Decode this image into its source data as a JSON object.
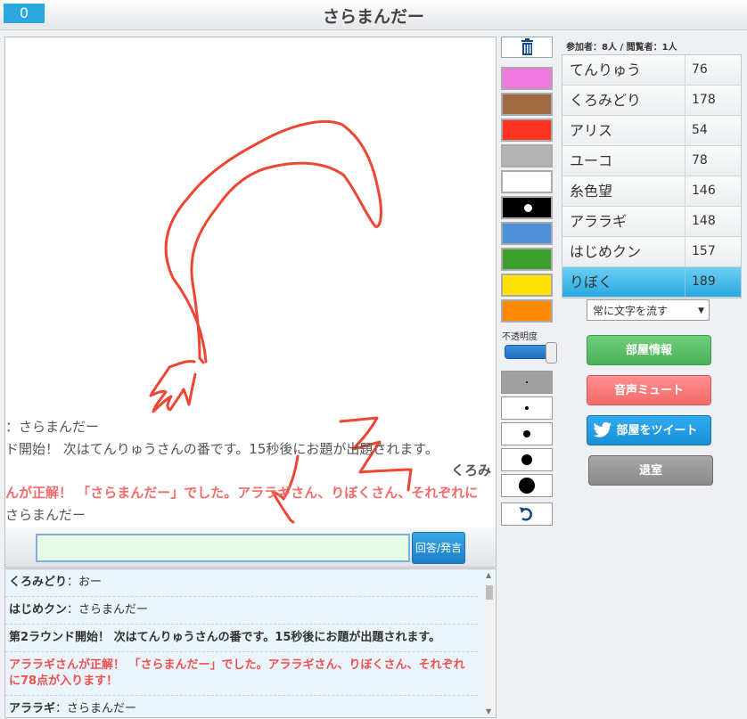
{
  "header": {
    "round_badge": "0",
    "title": "さらまんだー"
  },
  "canvas_messages": [
    {
      "text": "：さらまんだー",
      "style": "plain"
    },
    {
      "text": "ド開始！ 次はてんりゅうさんの番です。15秒後にお題が出題されます。",
      "style": "plain"
    },
    {
      "text": "くろみ",
      "style": "bold"
    },
    {
      "text": "んが正解！ 「さらまんだー」でした。アララギさん、りぼくさん、それぞれに",
      "style": "red"
    },
    {
      "text": "さらまんだー",
      "style": "plain"
    }
  ],
  "answer": {
    "input_value": "",
    "button_label": "回答/発言"
  },
  "chat": [
    {
      "name": "くろみどり",
      "sep": "：",
      "text": "おー",
      "kind": "user"
    },
    {
      "name": "はじめクン",
      "sep": "：",
      "text": "さらまんだー",
      "kind": "user"
    },
    {
      "name": "",
      "sep": "",
      "text": "第2ラウンド開始！ 次はてんりゅうさんの番です。15秒後にお題が出題されます。",
      "kind": "sys"
    },
    {
      "name": "",
      "sep": "",
      "text": "アララギさんが正解！ 「さらまんだー」でした。アララギさん、りぼくさん、それぞれに78点が入ります！",
      "kind": "ok"
    },
    {
      "name": "アララギ",
      "sep": "：",
      "text": "さらまんだー",
      "kind": "user"
    }
  ],
  "tools": {
    "colors": [
      "#f07adf",
      "#a06a40",
      "#ff3322",
      "#b3b3b3",
      "#ffffff",
      "#000000",
      "#4f92d8",
      "#3aa02a",
      "#ffe200",
      "#ff8a00"
    ],
    "selected_color": "#000000",
    "opacity_label": "不透明度",
    "opacity_value": 1.0,
    "trash_icon": "trash-icon",
    "undo_icon": "undo-icon"
  },
  "players_header": {
    "participants_label": "参加者",
    "participants_value": "8人",
    "separator": "/",
    "viewers_label": "閲覧者",
    "viewers_value": "1人"
  },
  "players": [
    {
      "name": "てんりゅう",
      "score": "76",
      "active": false
    },
    {
      "name": "くろみどり",
      "score": "178",
      "active": false
    },
    {
      "name": "アリス",
      "score": "54",
      "active": false
    },
    {
      "name": "ユーコ",
      "score": "78",
      "active": false
    },
    {
      "name": "糸色望",
      "score": "146",
      "active": false
    },
    {
      "name": "アララギ",
      "score": "148",
      "active": false
    },
    {
      "name": "はじめクン",
      "score": "157",
      "active": false
    },
    {
      "name": "りぼく",
      "score": "189",
      "active": true
    }
  ],
  "mode_select": {
    "value": "常に文字を流す"
  },
  "buttons": {
    "room_info": "部屋情報",
    "mute": "音声ミュート",
    "tweet": "部屋をツイート",
    "leave": "退室"
  }
}
